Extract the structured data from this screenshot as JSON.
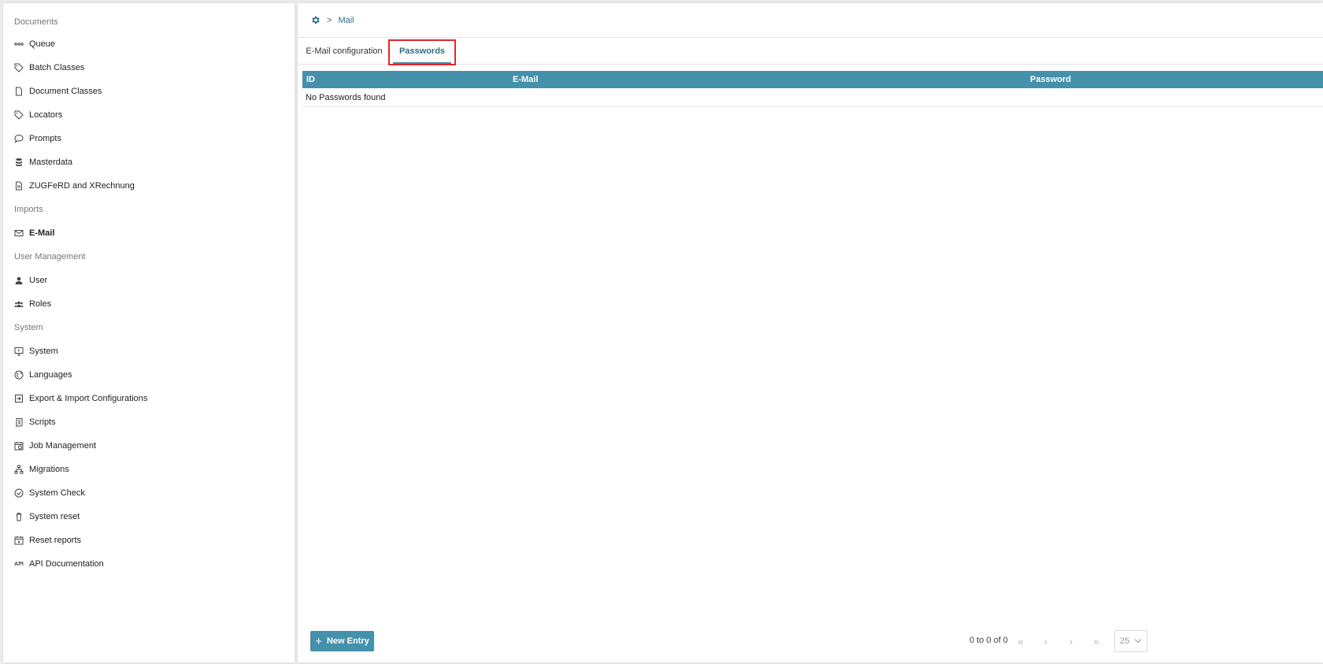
{
  "sidebar": {
    "sections": {
      "documents": "Documents",
      "imports": "Imports",
      "user_management": "User Management",
      "system": "System"
    },
    "items": {
      "queue": "Queue",
      "batch_classes": "Batch Classes",
      "document_classes": "Document Classes",
      "locators": "Locators",
      "prompts": "Prompts",
      "masterdata": "Masterdata",
      "zugferd": "ZUGFeRD and XRechnung",
      "email": "E-Mail",
      "user": "User",
      "roles": "Roles",
      "system": "System",
      "languages": "Languages",
      "export_import": "Export & Import Configurations",
      "scripts": "Scripts",
      "job_management": "Job Management",
      "migrations": "Migrations",
      "system_check": "System Check",
      "system_reset": "System reset",
      "reset_reports": "Reset reports",
      "api_docs": "API Documentation"
    },
    "active_item": "E-Mail",
    "api_icon_text": "API"
  },
  "breadcrumb": {
    "current": "Mail"
  },
  "tabs": {
    "email_config": "E-Mail configuration",
    "passwords": "Passwords",
    "active": "Passwords"
  },
  "table": {
    "columns": {
      "id": "ID",
      "email": "E-Mail",
      "password": "Password"
    },
    "empty_message": "No Passwords found"
  },
  "footer": {
    "new_entry": "New Entry",
    "new_entry_icon": "+",
    "range_text": "0 to 0 of 0",
    "first": "«",
    "prev": "‹",
    "next": "›",
    "last": "»",
    "page_size": "25"
  },
  "colors": {
    "accent": "#4591ab",
    "link": "#2f6f85",
    "highlight": "#e3262b"
  }
}
